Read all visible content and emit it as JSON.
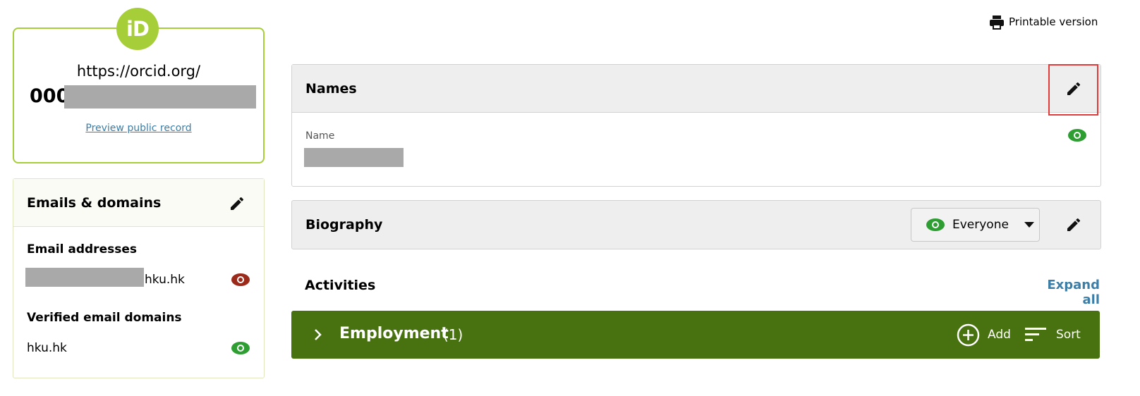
{
  "header": {
    "printable_label": "Printable version"
  },
  "id_card": {
    "badge_text": "iD",
    "url": "https://orcid.org/",
    "id_visible_prefix": "000",
    "preview_link": "Preview public record"
  },
  "emails": {
    "title": "Emails & domains",
    "addresses_heading": "Email addresses",
    "address_domain_suffix": "hku.hk",
    "address_visibility_color": "#9b2a1b",
    "verified_heading": "Verified email domains",
    "verified_domain": "hku.hk",
    "verified_visibility_color": "#2e9e32"
  },
  "names": {
    "title": "Names",
    "name_label": "Name"
  },
  "biography": {
    "title": "Biography",
    "visibility": "Everyone"
  },
  "activities": {
    "title": "Activities",
    "expand_all": "Expand all",
    "employment": {
      "title": "Employment",
      "count": "(1)",
      "add_label": "Add",
      "sort_label": "Sort"
    }
  },
  "colors": {
    "orcid_green": "#a6ce39",
    "employment_bar": "#48720f",
    "link_blue": "#3d7ea6",
    "highlight_red": "#e03c3c"
  },
  "icons": [
    "printer-icon",
    "pencil-icon",
    "eye-icon",
    "chevron-right-icon",
    "caret-down-icon",
    "plus-circle-icon",
    "sort-icon"
  ]
}
